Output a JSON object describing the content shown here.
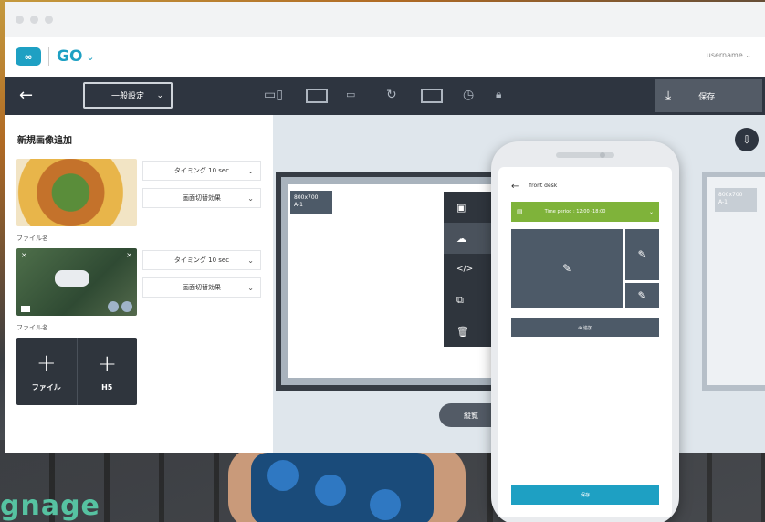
{
  "brand": {
    "logo_text": "∞",
    "app_name": "GO",
    "app_chevron": "⌄",
    "footer_brand": "gnage"
  },
  "user": {
    "name": "username",
    "chevron": "⌄"
  },
  "toolbar": {
    "back_icon": "←",
    "general_select": "一般設定",
    "select_chevron": "⌄",
    "save_label": "保存",
    "save_icon": "⤓",
    "tools": [
      {
        "icon": "devices-icon",
        "glyph": "▭▯"
      },
      {
        "icon": "image-edit-icon",
        "glyph": ""
      },
      {
        "icon": "ticker-icon",
        "glyph": "▭"
      },
      {
        "icon": "refresh-icon",
        "glyph": "↻"
      },
      {
        "icon": "video-icon",
        "glyph": ""
      },
      {
        "icon": "clock-icon",
        "glyph": "◷"
      },
      {
        "icon": "lock-icon",
        "glyph": "🔒︎"
      }
    ]
  },
  "left_panel": {
    "title": "新規画像追加",
    "items": [
      {
        "filename": "ファイル名",
        "timing": "タイミング 10 sec",
        "transition": "画面切替効果",
        "chevron": "⌄"
      },
      {
        "filename": "ファイル名",
        "timing": "タイミング 10 sec",
        "transition": "画面切替効果",
        "chevron": "⌄"
      }
    ],
    "add_file_label": "ファイル",
    "add_h5_label": "H5",
    "plus": "+"
  },
  "canvas": {
    "resolution_badge": "800x700\nA-1",
    "context_menu": [
      {
        "icon": "image-icon",
        "glyph": "▣",
        "active": false
      },
      {
        "icon": "cloud-icon",
        "glyph": "☁",
        "active": true
      },
      {
        "icon": "code-icon",
        "glyph": "</>",
        "active": false
      },
      {
        "icon": "copy-icon",
        "glyph": "⧉",
        "active": false
      },
      {
        "icon": "trash-icon",
        "glyph": "🗑︎",
        "active": false
      }
    ],
    "preview_label": "縦覧",
    "export_icon": "⇩"
  },
  "phone": {
    "back": "←",
    "title": "front desk",
    "time_period": "Time period : 12:00 -18:00",
    "time_icon": "▤",
    "chevron": "⌄",
    "edit_icon": "✎",
    "add_label": "⊕ 追加",
    "save_label": "保存"
  }
}
